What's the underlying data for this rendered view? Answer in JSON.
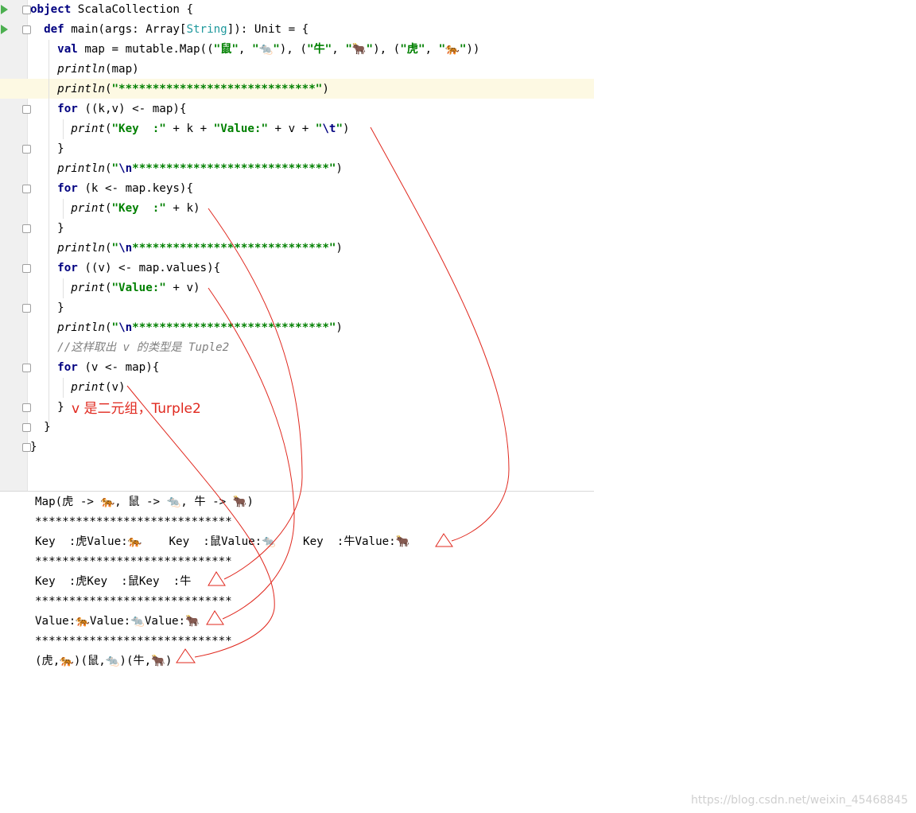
{
  "editor": {
    "code_lines": [
      {
        "t": "object ScalaCollection {"
      },
      {
        "t": "  def main(args: Array[String]): Unit = {"
      },
      {
        "t": "    val map = mutable.Map((\"鼠\", \"🐀\"), (\"牛\", \"🐂\"), (\"虎\", \"🐅\"))"
      },
      {
        "t": "    println(map)"
      },
      {
        "t": "    println(\"*****************************\")"
      },
      {
        "t": "    for ((k,v) <- map){"
      },
      {
        "t": "      print(\"Key  :\" + k + \"Value:\" + v + \"\\t\")"
      },
      {
        "t": "    }"
      },
      {
        "t": "    println(\"\\n*****************************\")"
      },
      {
        "t": "    for (k <- map.keys){"
      },
      {
        "t": "      print(\"Key  :\" + k)"
      },
      {
        "t": "    }"
      },
      {
        "t": "    println(\"\\n*****************************\")"
      },
      {
        "t": "    for ((v) <- map.values){"
      },
      {
        "t": "      print(\"Value:\" + v)"
      },
      {
        "t": "    }"
      },
      {
        "t": "    println(\"\\n*****************************\")"
      },
      {
        "t": "    //这样取出 v 的类型是 Tuple2"
      },
      {
        "t": "    for (v <- map){"
      },
      {
        "t": "      print(v)"
      },
      {
        "t": "    }"
      },
      {
        "t": "  }"
      },
      {
        "t": "}"
      }
    ],
    "annotation": "v 是二元组，Turple2"
  },
  "console": {
    "lines": [
      "Map(虎 -> 🐅, 鼠 -> 🐀, 牛 -> 🐂)",
      "*****************************",
      "Key  :虎Value:🐅    Key  :鼠Value:🐀    Key  :牛Value:🐂",
      "*****************************",
      "Key  :虎Key  :鼠Key  :牛",
      "*****************************",
      "Value:🐅Value:🐀Value:🐂",
      "*****************************",
      "(虎,🐅)(鼠,🐀)(牛,🐂)"
    ]
  },
  "watermark": "https://blog.csdn.net/weixin_45468845",
  "colors": {
    "keyword": "#000080",
    "string": "#008000",
    "comment": "#808080",
    "annotation": "#e0281e",
    "highlight_line": "#fdf9e3"
  }
}
